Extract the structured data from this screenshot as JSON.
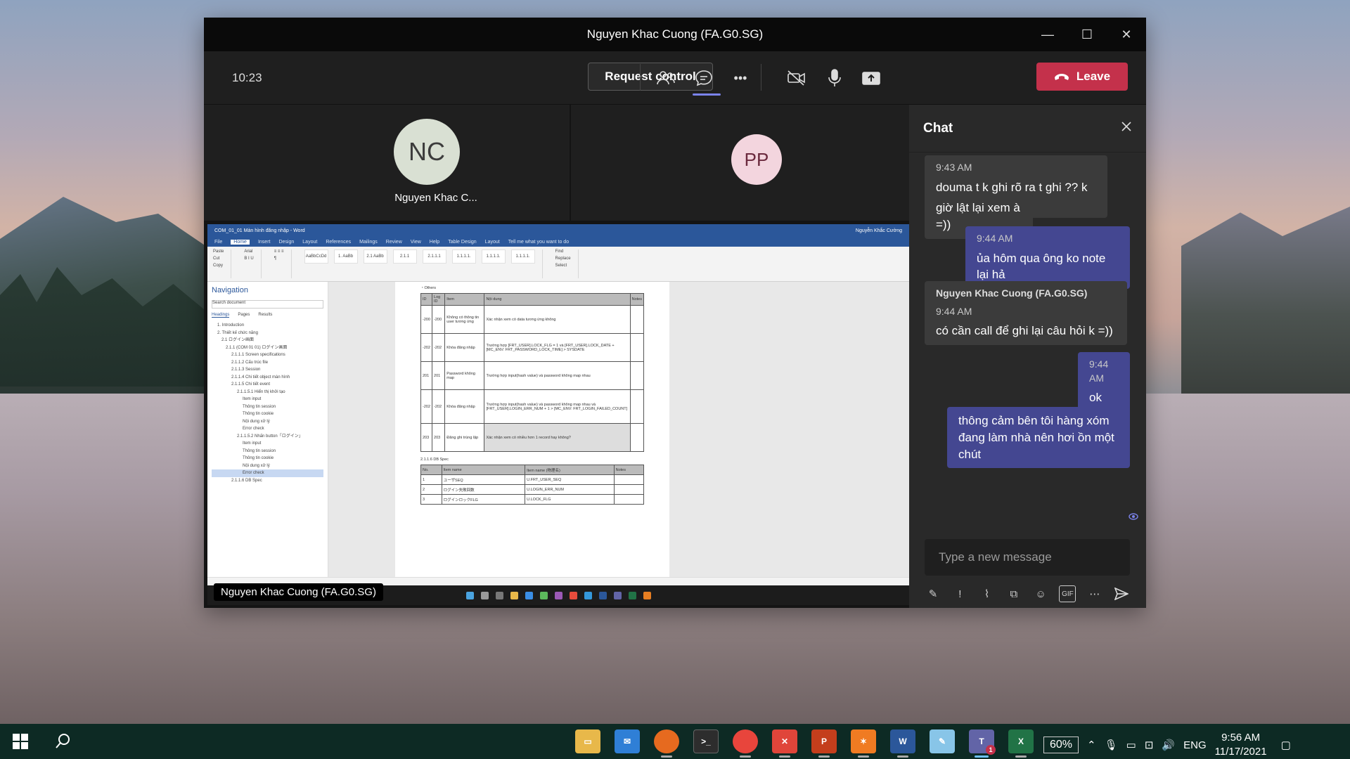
{
  "window": {
    "title": "Nguyen Khac Cuong (FA.G0.SG)",
    "minimize": "—",
    "maximize": "☐",
    "close": "✕"
  },
  "toolbar": {
    "time": "10:23",
    "request_control": "Request control",
    "leave": "Leave",
    "more": "•••"
  },
  "participants": {
    "nc_initials": "NC",
    "nc_name": "Nguyen Khac C...",
    "pp_initials": "PP"
  },
  "share": {
    "label": "Nguyen Khac Cuong (FA.G0.SG)",
    "word_title": "COM_01_01 Màn hình đăng nhập - Word",
    "word_user": "Nguyễn Khắc Cường",
    "menu": [
      "File",
      "Home",
      "Insert",
      "Design",
      "Layout",
      "References",
      "Mailings",
      "Review",
      "View",
      "Help",
      "Table Design",
      "Layout",
      "Tell me what you want to do"
    ],
    "nav_title": "Navigation",
    "nav_search": "Search document",
    "nav_tabs": [
      "Headings",
      "Pages",
      "Results"
    ],
    "nav_tree": [
      "1. Introduction",
      "2. Thiết kế chức năng",
      "2.1 ログイン画面",
      "2.1.1 (COM 01 01) ログイン画面",
      "2.1.1.1 Screen specifications",
      "2.1.1.2 Cấu trúc file",
      "2.1.1.3 Session",
      "2.1.1.4 Chi tiết object màn hình",
      "2.1.1.5 Chi tiết event",
      "2.1.1.5.1 Hiển thị khởi tạo",
      "Item input",
      "Thông tin session",
      "Thông tin cookie",
      "Nội dung xử lý",
      "Error check",
      "2.1.1.5.2 Nhấn button「ログイン」",
      "Item input",
      "Thông tin session",
      "Thông tin cookie",
      "Nội dung xử lý",
      "Error check",
      "2.1.1.6 DB Spec"
    ],
    "doc_heading": "・Others",
    "table_headers": [
      "ID",
      "Log ID",
      "Item",
      "Nội dung",
      "Notes"
    ],
    "table_rows": [
      [
        "-200",
        "-200",
        "Không có thông tin user tương ứng",
        "Xác nhận xem có data tương ứng không",
        ""
      ],
      [
        "-202",
        "-202",
        "Khóa đăng nhập",
        "Trường hợp [FRT_USER].LOCK_FLG = 1 và [FRT_USER].LOCK_DATE + [MC_ENV: FRT_PASSWORD_LOCK_TIME] > SYSDATE",
        ""
      ],
      [
        "201",
        "201",
        "Password không map",
        "Trường hợp input(hash value) và password không map nhau",
        ""
      ],
      [
        "-202",
        "-202",
        "Khóa đăng nhập",
        "Trường hợp input(hash value) và password không map nhau và [FRT_USER].LOGIN_ERR_NUM + 1 > [MC_ENV: FRT_LOGIN_FAILED_COUNT]",
        ""
      ],
      [
        "203",
        "203",
        "Đăng ghi trùng lặp",
        "Xác nhận xem có nhiều hơn 1 record hay không?",
        ""
      ]
    ],
    "db_heading": "2.1.1.6 DB Spec",
    "db_headers": [
      "No.",
      "Item name",
      "Item name (物理名)",
      "Notes"
    ],
    "db_rows": [
      [
        "1",
        "ユーザSEQ",
        "U.FRT_USER_SEQ",
        ""
      ],
      [
        "2",
        "ログイン失敗回数",
        "U.LOGIN_ERR_NUM",
        ""
      ],
      [
        "3",
        "ログインロックFLG",
        "U.LOCK_FLG",
        ""
      ]
    ]
  },
  "chat": {
    "title": "Chat",
    "messages": [
      {
        "time": "9:43 AM",
        "text": "douma t k ghi rõ ra t ghi ?? k =))"
      },
      {
        "text": "giờ lật lại xem à =))"
      },
      {
        "time": "9:44 AM",
        "text": "ủa hôm qua ông ko note lại hả"
      },
      {
        "name": "Nguyen Khac Cuong (FA.G0.SG)",
        "time": "9:44 AM",
        "text": "có cần call để ghi lại câu hỏi k =))"
      },
      {
        "time": "9:44 AM",
        "text": "ok"
      },
      {
        "text": "thông cảm bên tôi hàng xóm đang làm nhà nên hơi ồn một chút"
      }
    ],
    "compose_placeholder": "Type a new message"
  },
  "taskbar": {
    "battery_pct": "60%",
    "lang": "ENG",
    "time": "9:56 AM",
    "date": "11/17/2021",
    "teams_badge": "1"
  },
  "colors": {
    "leave": "#c4314b",
    "my_bubble": "#444791",
    "accent": "#7b83eb"
  }
}
